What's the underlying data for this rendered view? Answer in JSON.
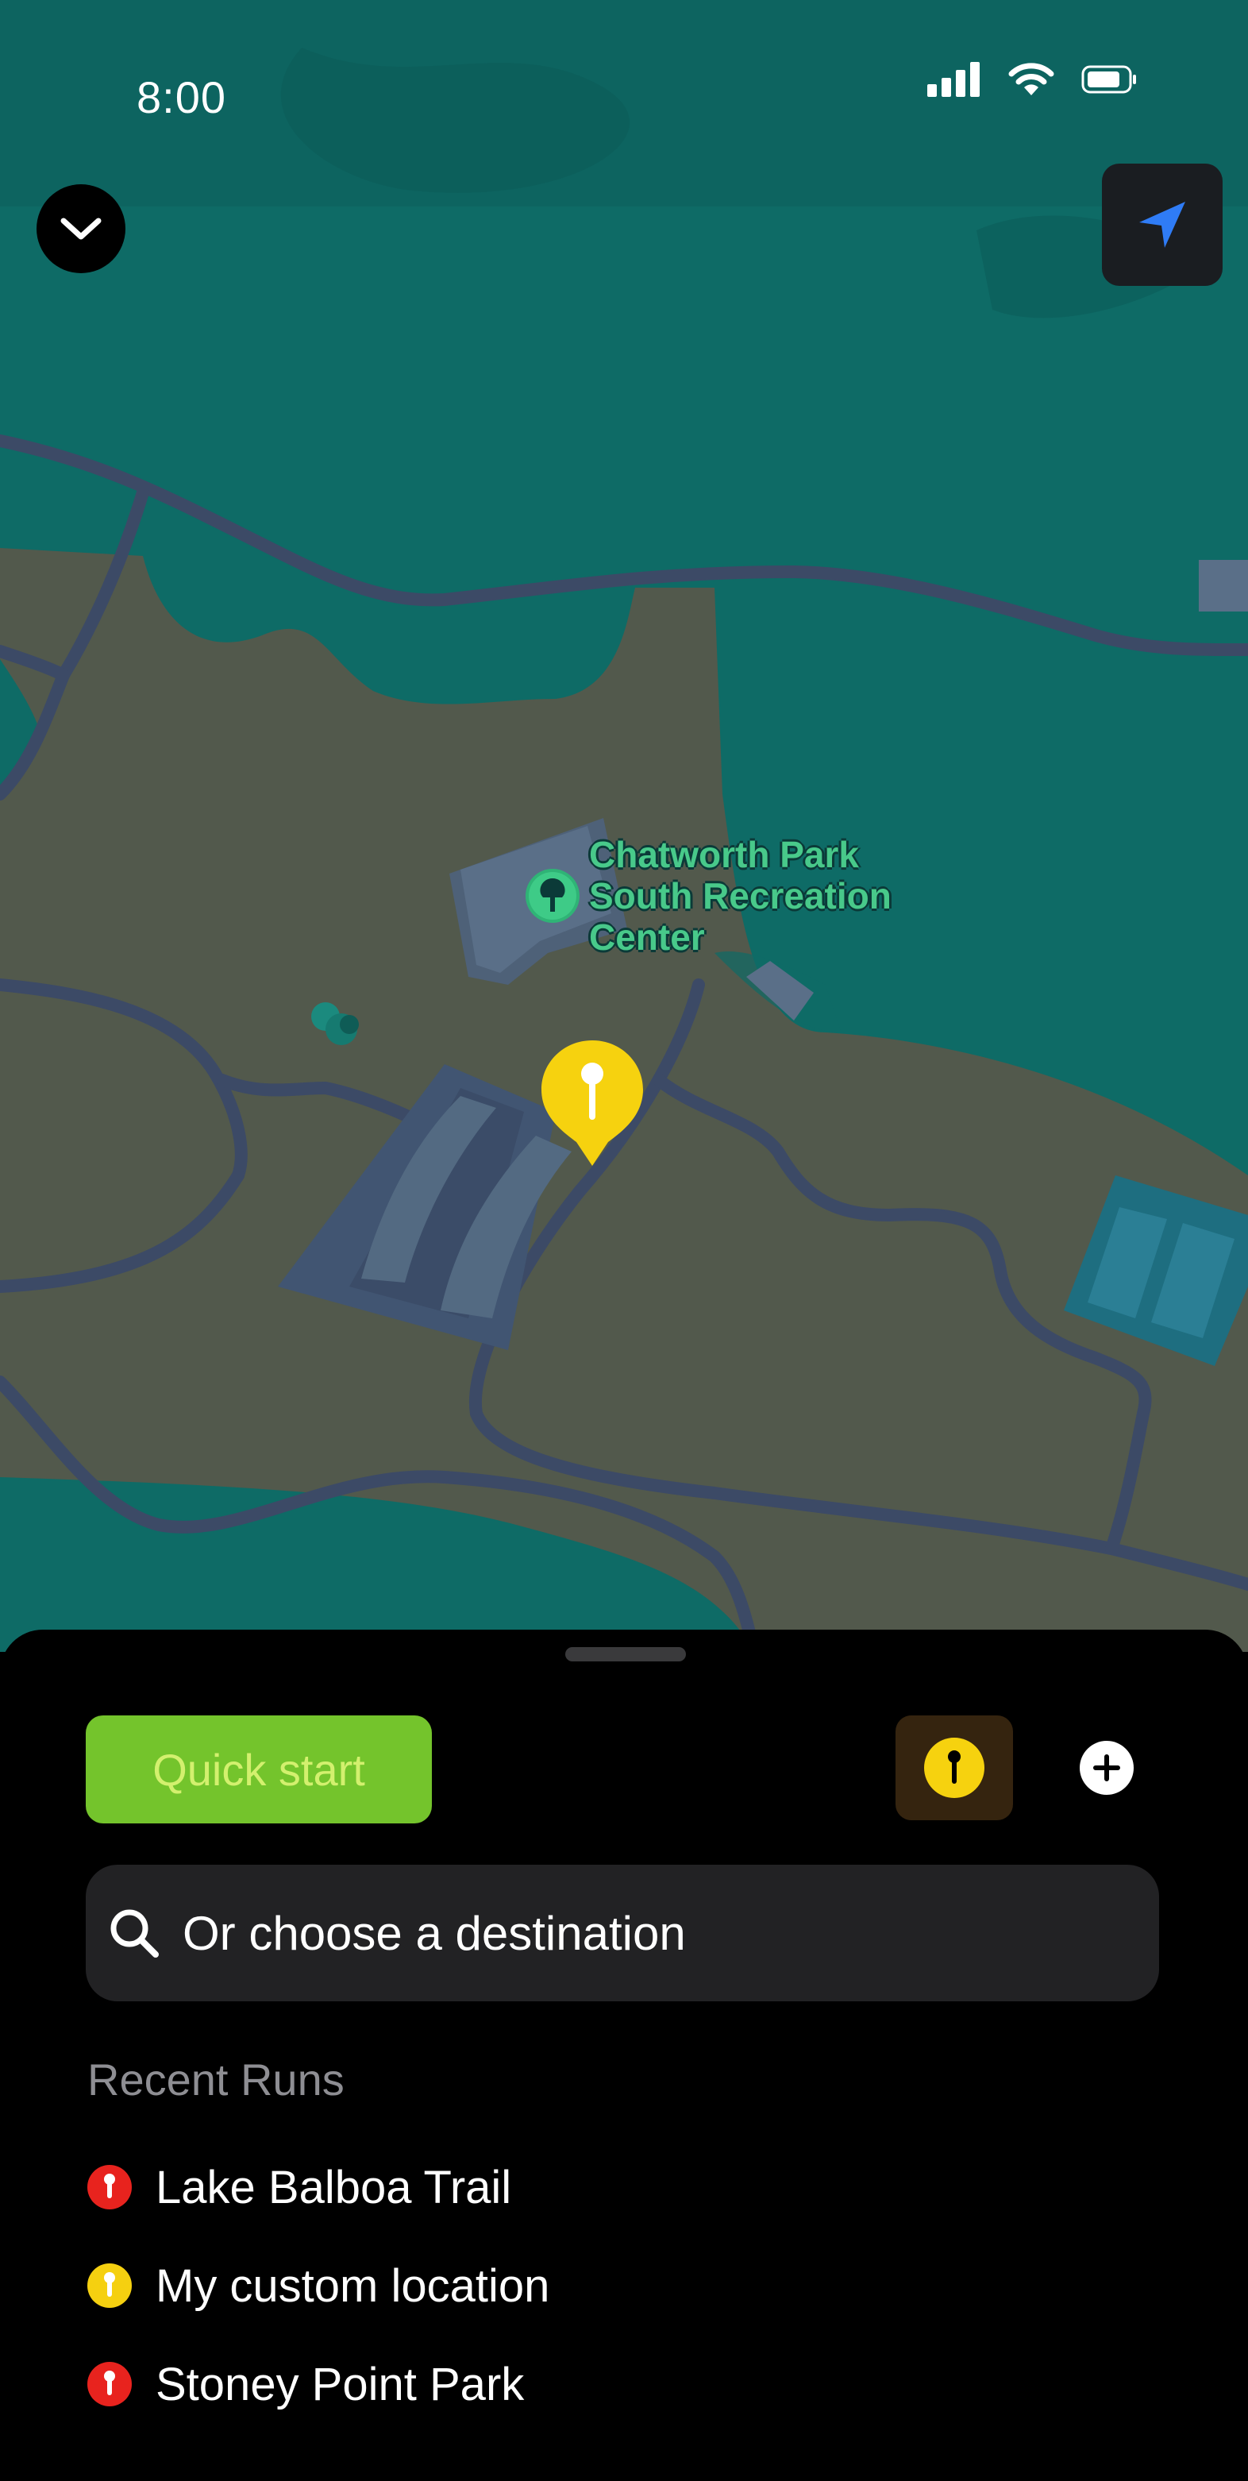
{
  "status_bar": {
    "time": "8:00"
  },
  "map": {
    "poi_label": [
      "Chatworth Park",
      "South Recreation",
      "Center"
    ],
    "colors": {
      "water": "#0e6b66",
      "land": "#52594c",
      "road": "#3c4a66",
      "building": "#536a82"
    }
  },
  "sheet": {
    "quick_start_label": "Quick start",
    "search": {
      "placeholder": "Or choose a destination"
    },
    "recent_heading": "Recent Runs",
    "recent_runs": [
      {
        "label": "Lake Balboa Trail",
        "color": "#e8231e"
      },
      {
        "label": "My custom location",
        "color": "#f5d010"
      },
      {
        "label": "Stoney Point Park",
        "color": "#e8231e"
      }
    ]
  }
}
